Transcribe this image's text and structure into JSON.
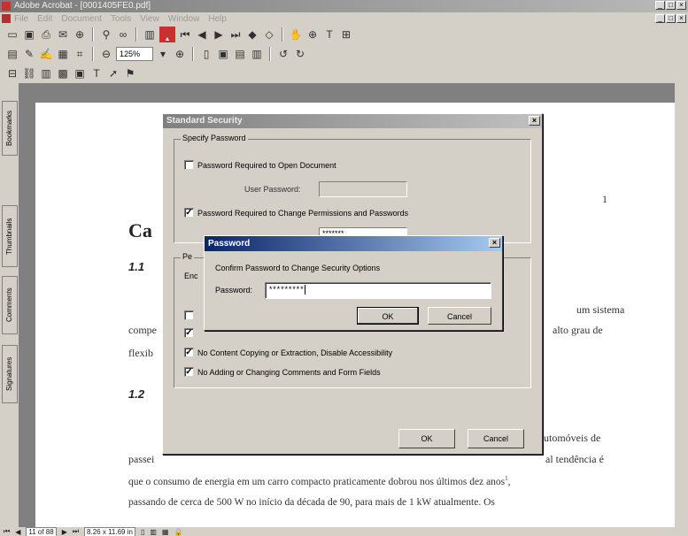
{
  "window": {
    "title": "Adobe Acrobat - [0001405FE0.pdf]",
    "menu": [
      "File",
      "Edit",
      "Document",
      "Tools",
      "View",
      "Window",
      "Help"
    ]
  },
  "toolbar": {
    "zoom": "125%"
  },
  "sidebar_tabs": [
    "Bookmarks",
    "Thumbnails",
    "Comments",
    "Signatures"
  ],
  "document": {
    "page_number": "1",
    "heading": "Ca",
    "sub1": "1.1",
    "line1_right": "um sistema",
    "line2_left": "compe",
    "line2_right": "alto grau de",
    "line3_left": "flexib",
    "sub2": "1.2",
    "line4_right": "utomóveis de",
    "line5_left": "passei",
    "line5_right": "al tendência é",
    "line6": "que o consumo de energia em um carro compacto praticamente dobrou nos últimos dez anos",
    "line6_sup": "1",
    "line7": "passando de cerca de 500 W no início da década de 90, para mais de 1 kW atualmente. Os"
  },
  "status": {
    "page": "11 of 88",
    "size": "8.26 x 11.69 in"
  },
  "standard_security": {
    "title": "Standard Security",
    "specify_password": "Specify Password",
    "open_doc_checkbox": "Password Required to Open Document",
    "user_password_label": "User Password:",
    "change_perms_checkbox": "Password Required to Change Permissions and Passwords",
    "masked_value": "*******",
    "permissions_partial": "Pe",
    "encryption_partial": "Enc",
    "copy_checkbox": "No Content Copying or Extraction, Disable Accessibility",
    "comments_checkbox": "No Adding or Changing Comments and Form Fields",
    "ok": "OK",
    "cancel": "Cancel"
  },
  "password_dialog": {
    "title": "Password",
    "prompt": "Confirm Password to Change Security Options",
    "label": "Password:",
    "value": "*********",
    "ok": "OK",
    "cancel": "Cancel"
  }
}
